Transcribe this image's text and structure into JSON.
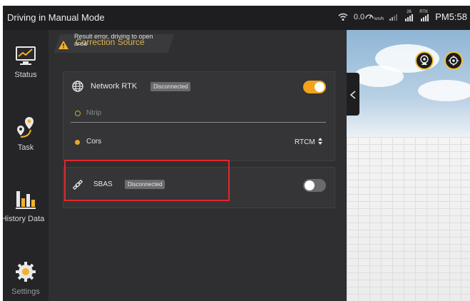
{
  "statusbar": {
    "title": "Driving in Manual Mode",
    "speed": "0.0",
    "speed_unit": "km/h",
    "rtk_label": "RTK",
    "clock": "PM5:58",
    "sat_count": "26"
  },
  "sidebar": {
    "items": [
      {
        "label": "Status"
      },
      {
        "label": "Task"
      },
      {
        "label": "History Data"
      },
      {
        "label": "Settings"
      }
    ]
  },
  "main": {
    "section_title": "Correction Source",
    "warning_text": "Result error, driving to open area",
    "network_rtk": {
      "label": "Network RTK",
      "status": "Disconnected",
      "enabled": true,
      "options": [
        {
          "label": "Ntrip",
          "selected": false
        },
        {
          "label": "Cors",
          "selected": true
        }
      ],
      "format_value": "RTCM"
    },
    "sbas": {
      "label": "SBAS",
      "status": "Disconnected",
      "enabled": false
    }
  },
  "colors": {
    "accent": "#f2a31b",
    "highlight_box": "#e0282c",
    "title_gold": "#d9b54a"
  }
}
